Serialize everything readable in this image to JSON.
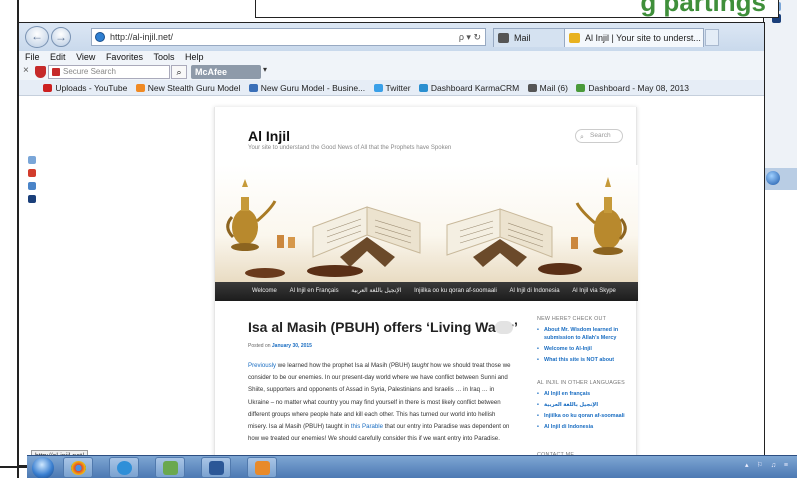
{
  "caption": {
    "visible_fragment": "g partings"
  },
  "browser": {
    "address": "http://al-injil.net/",
    "address_tools": "ρ ▾ ↻",
    "tabs": [
      {
        "label": "Mail",
        "icon": "mail-icon",
        "active": false
      },
      {
        "label": "Al Injil | Your site to underst... ×",
        "icon": "site-icon",
        "active": true
      }
    ],
    "menu": [
      "File",
      "Edit",
      "View",
      "Favorites",
      "Tools",
      "Help"
    ],
    "search": {
      "placeholder": "Secure Search",
      "mcafee_label": "McAfee",
      "close_glyph": "×"
    },
    "favorites": [
      {
        "label": "",
        "icon": "star-icon",
        "color": "#e8b220"
      },
      {
        "label": "Uploads - YouTube",
        "icon": "youtube-icon",
        "color": "#cc2020"
      },
      {
        "label": "New Stealth Guru Model",
        "icon": "rss-icon",
        "color": "#f08a24"
      },
      {
        "label": "New Guru Model - Busine...",
        "icon": "page-icon",
        "color": "#3a6fb8"
      },
      {
        "label": "Twitter",
        "icon": "twitter-icon",
        "color": "#3aa0e8"
      },
      {
        "label": "Dashboard KarmaCRM",
        "icon": "karma-icon",
        "color": "#2a8fd0"
      },
      {
        "label": "Mail (6)",
        "icon": "mail-icon",
        "color": "#555555"
      },
      {
        "label": "Dashboard - May 08, 2013",
        "icon": "chart-icon",
        "color": "#4a9a3a"
      }
    ],
    "status_url": "http://al-injil.net/"
  },
  "site": {
    "title": "Al Injil",
    "description": "Your site to understand the Good News of All that the Prophets have Spoken",
    "search_placeholder": "Search",
    "nav": [
      "Welcome",
      "Al Injil en Français",
      "الإنجيل باللغة العربية",
      "Injiilka oo ku qoran af-soomaali",
      "Al Injil di Indonesia",
      "Al Injil via Skype"
    ],
    "post": {
      "title": "Isa al Masih (PBUH) offers ‘Living Water’",
      "date_prefix": "Posted on ",
      "date": "January 30, 2015",
      "body_link1": "Previously",
      "body_part1": " we learned how the prophet Isa al Masih (PBUH) ",
      "body_em": "taught",
      "body_part2": " how we should treat those we consider to be our enemies. In our present-day world where we have conflict between Sunni and Shiite, supporters and opponents of Assad in Syria, Palestinians and Israelis … in Iraq … in Ukraine – no matter what country you may find yourself in there is most likely conflict between different groups where people hate and kill each other. This has turned our world into hellish misery. Isa al Masih (PBUH) taught in ",
      "body_link2": "this Parable",
      "body_part3": " that our entry into Paradise was dependent on how we treated our enemies! We should carefully consider this if we want entry into Paradise."
    },
    "sidebar": {
      "new_title": "NEW HERE? CHECK OUT",
      "new_items": [
        "About Mr. Wisdom learned in submission to Allah’s Mercy",
        "Welcome to Al-Injil",
        "What this site is NOT about"
      ],
      "lang_title": "AL INJIL IN OTHER LANGUAGES",
      "lang_items": [
        "Al Injil en français",
        "الإنجيل باللغة العربية",
        "Injiilka oo ku qoran af-soomaali",
        "Al Injil di Indonesia"
      ],
      "contact_title": "CONTACT ME"
    }
  },
  "taskbar": {
    "apps": [
      {
        "name": "chrome-icon",
        "color": "#e0452c"
      },
      {
        "name": "internet-explorer-icon",
        "color": "#2f8fd8"
      },
      {
        "name": "explorer-icon",
        "color": "#6aa84f"
      },
      {
        "name": "word-icon",
        "color": "#2b5797"
      },
      {
        "name": "office-icon",
        "color": "#e88a2a"
      }
    ],
    "tray_text": "▴ ⚐ ♫ ≡"
  },
  "colors": {
    "link": "#1b6ec2",
    "navbar": "#222222",
    "caption_text": "#3f8f3a"
  }
}
